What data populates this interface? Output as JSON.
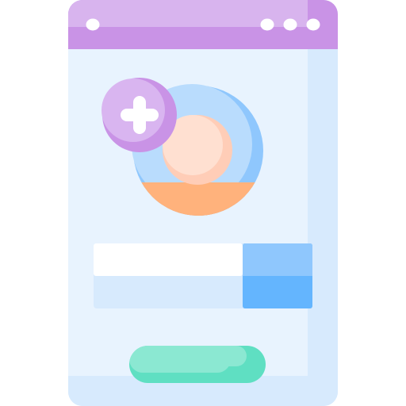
{
  "icon": {
    "name": "add-profile-photo-illustration",
    "parts": [
      "window-frame",
      "title-bar",
      "window-dots",
      "profile-avatar",
      "add-badge-plus-icon",
      "input-field",
      "submit-button"
    ]
  },
  "colors": {
    "frame_light": "#e8f3fe",
    "frame_shadow": "#d7eafd",
    "titlebar": "#d8b4ee",
    "titlebar_shadow": "#c993e6",
    "avatar_bg": "#b9dcfd",
    "avatar_bg_shadow": "#8fc7fd",
    "avatar_face": "#ffe0d1",
    "avatar_face_shadow": "#ffcdb7",
    "avatar_body": "#ffb27c",
    "avatar_body_shadow": "#fe9a5c",
    "badge": "#d9b5f0",
    "badge_shadow": "#c993e6",
    "input_top": "#ffffff",
    "input_bottom": "#d7eafd",
    "input_button": "#8fc7fd",
    "input_button_shadow": "#64b5fe",
    "submit": "#8be8d2",
    "submit_shadow": "#5fdfc2"
  }
}
